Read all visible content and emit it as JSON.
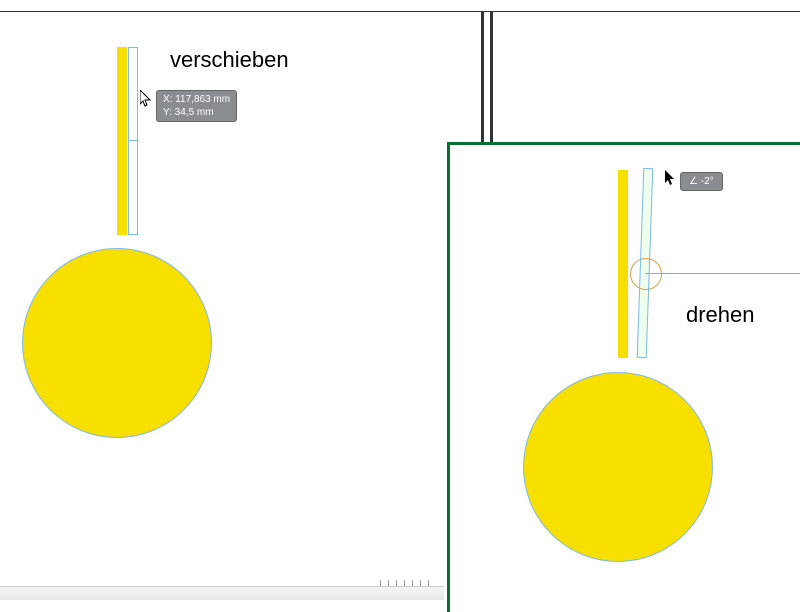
{
  "labels": {
    "verschieben": "verschieben",
    "drehen": "drehen"
  },
  "tooltip_left": {
    "x_label": "X: 117,863 mm",
    "y_label": "Y: 34,5 mm"
  },
  "tooltip_right": {
    "angle_label": "∠  -2°"
  },
  "colors": {
    "yellow": "#f7df00",
    "selection_blue": "#7cb9e8",
    "panel_border": "#0b6e2e",
    "tooltip_bg": "#8a8d90"
  }
}
